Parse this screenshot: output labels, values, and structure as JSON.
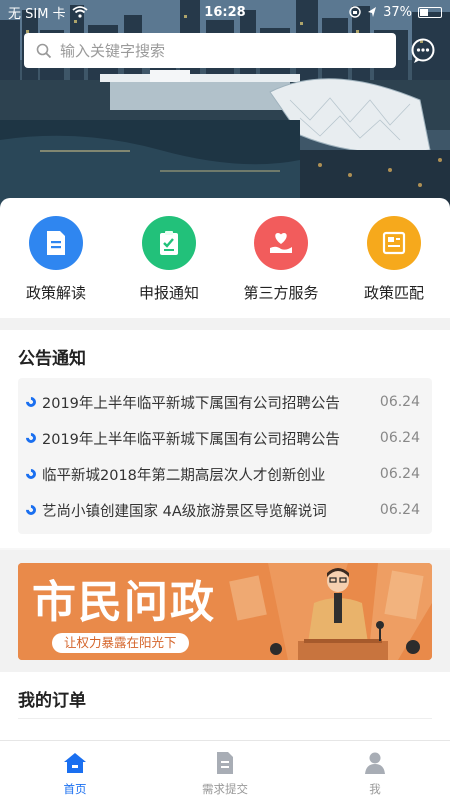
{
  "status_bar": {
    "carrier": "无 SIM 卡",
    "time": "16:28",
    "battery": "37%"
  },
  "search": {
    "placeholder": "输入关键字搜索"
  },
  "categories": [
    {
      "label": "政策解读",
      "icon": "document-icon",
      "color": "#2f86f0"
    },
    {
      "label": "申报通知",
      "icon": "clipboard-check-icon",
      "color": "#22c17a"
    },
    {
      "label": "第三方服务",
      "icon": "heart-hand-icon",
      "color": "#f25c5c"
    },
    {
      "label": "政策匹配",
      "icon": "match-icon",
      "color": "#f6a91c"
    }
  ],
  "notices": {
    "title": "公告通知",
    "items": [
      {
        "title": "2019年上半年临平新城下属国有公司招聘公告",
        "date": "06.24"
      },
      {
        "title": "2019年上半年临平新城下属国有公司招聘公告",
        "date": "06.24"
      },
      {
        "title": "临平新城2018年第二期高层次人才创新创业",
        "date": "06.24"
      },
      {
        "title": "艺尚小镇创建国家 4A级旅游景区导览解说词",
        "date": "06.24"
      }
    ]
  },
  "banner": {
    "title": "市民问政",
    "subtitle": "让权力暴露在阳光下"
  },
  "orders": {
    "title": "我的订单"
  },
  "tabs": [
    {
      "label": "首页",
      "icon": "home-icon",
      "active": true
    },
    {
      "label": "需求提交",
      "icon": "file-icon",
      "active": false
    },
    {
      "label": "我",
      "icon": "person-icon",
      "active": false
    }
  ],
  "colors": {
    "accent": "#1a6ff0",
    "banner_bg": "#e98a4a"
  }
}
